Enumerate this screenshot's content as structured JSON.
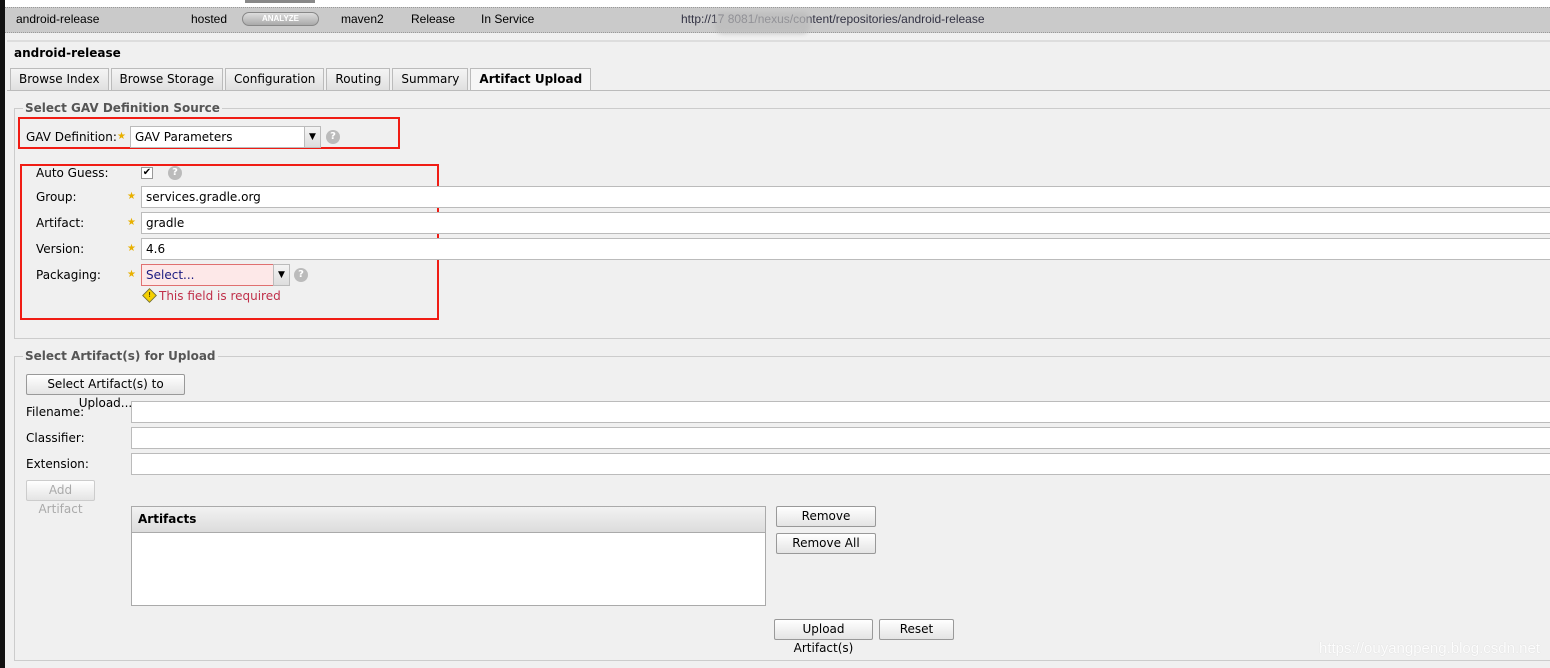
{
  "repo_row": {
    "name": "android-release",
    "type": "hosted",
    "analyze": "ANALYZE",
    "format": "maven2",
    "policy": "Release",
    "status": "In Service",
    "url": "http://17          8081/nexus/content/repositories/android-release"
  },
  "panel_title": "android-release",
  "tabs": [
    {
      "label": "Browse Index"
    },
    {
      "label": "Browse Storage"
    },
    {
      "label": "Configuration"
    },
    {
      "label": "Routing"
    },
    {
      "label": "Summary"
    },
    {
      "label": "Artifact Upload",
      "active": true
    }
  ],
  "gav_source": {
    "legend": "Select GAV Definition Source",
    "gav_label": "GAV Definition:",
    "gav_value": "GAV Parameters"
  },
  "gav_params": {
    "auto_guess_label": "Auto Guess:",
    "auto_guess_checked": true,
    "group_label": "Group:",
    "group_value": "services.gradle.org",
    "artifact_label": "Artifact:",
    "artifact_value": "gradle",
    "version_label": "Version:",
    "version_value": "4.6",
    "packaging_label": "Packaging:",
    "packaging_value": "Select...",
    "error": "This field is required"
  },
  "upload": {
    "legend": "Select Artifact(s) for Upload",
    "select_button": "Select Artifact(s) to Upload...",
    "filename_label": "Filename:",
    "classifier_label": "Classifier:",
    "extension_label": "Extension:",
    "add_button": "Add Artifact",
    "artifacts_header": "Artifacts",
    "remove": "Remove",
    "remove_all": "Remove All",
    "upload_button": "Upload Artifact(s)",
    "reset": "Reset"
  },
  "watermark": "https://ouyangpeng.blog.csdn.net",
  "colors": {
    "highlight": "#f01c14",
    "error": "#c0304a",
    "required_star": "#e8b000"
  }
}
